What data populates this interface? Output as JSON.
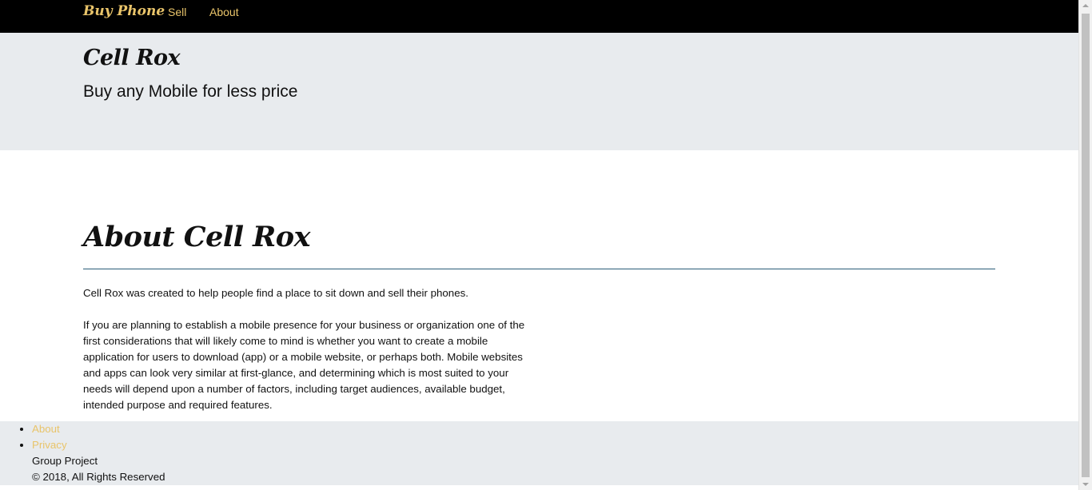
{
  "navbar": {
    "brand": "Buy Phone",
    "links": [
      "Sell",
      "About"
    ]
  },
  "jumbotron": {
    "title": "Cell Rox",
    "subtitle": "Buy any Mobile for less price"
  },
  "main": {
    "heading": "About Cell Rox",
    "paragraphs": [
      "Cell Rox was created to help people find a place to sit down and sell their phones.",
      "If you are planning to establish a mobile presence for your business or organization one of the first considerations that will likely come to mind is whether you want to create a mobile application for users to download (app) or a mobile website, or perhaps both. Mobile websites and apps can look very similar at first-glance, and determining which is most suited to your needs will depend upon a number of factors, including target audiences, available budget, intended purpose and required features."
    ]
  },
  "footer": {
    "links": [
      "About",
      "Privacy"
    ],
    "group": "Group Project",
    "copyright": "© 2018, All Rights Reserved"
  },
  "colors": {
    "navbar_bg": "#000000",
    "accent": "#e9c46a",
    "jumbotron_bg": "#e8ebee",
    "divider": "#2a5d78"
  }
}
